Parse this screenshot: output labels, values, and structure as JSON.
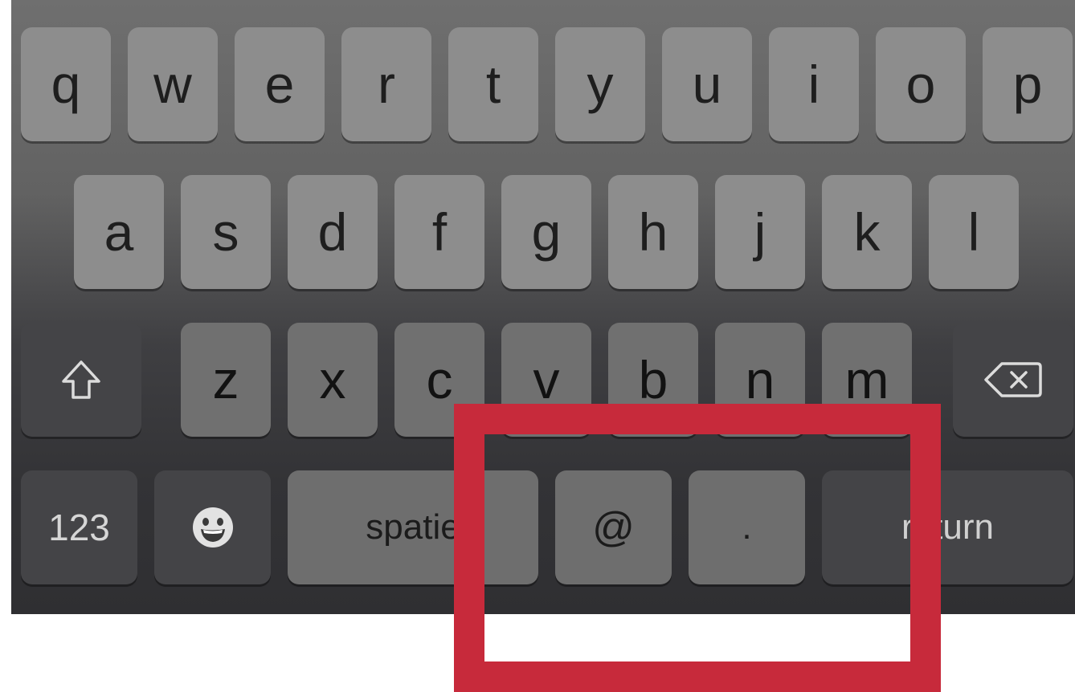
{
  "keyboard": {
    "row1": [
      "q",
      "w",
      "e",
      "r",
      "t",
      "y",
      "u",
      "i",
      "o",
      "p"
    ],
    "row2": [
      "a",
      "s",
      "d",
      "f",
      "g",
      "h",
      "j",
      "k",
      "l"
    ],
    "row3": [
      "z",
      "x",
      "c",
      "v",
      "b",
      "n",
      "m"
    ],
    "bottom": {
      "numbers_label": "123",
      "space_label": "spatie",
      "at_label": "@",
      "dot_label": ".",
      "return_label": "return"
    },
    "icons": {
      "shift": "shift-arrow-icon",
      "backspace": "backspace-icon",
      "emoji": "emoji-smiley-icon"
    }
  },
  "annotation": {
    "highlight_color": "#c72a3b"
  }
}
